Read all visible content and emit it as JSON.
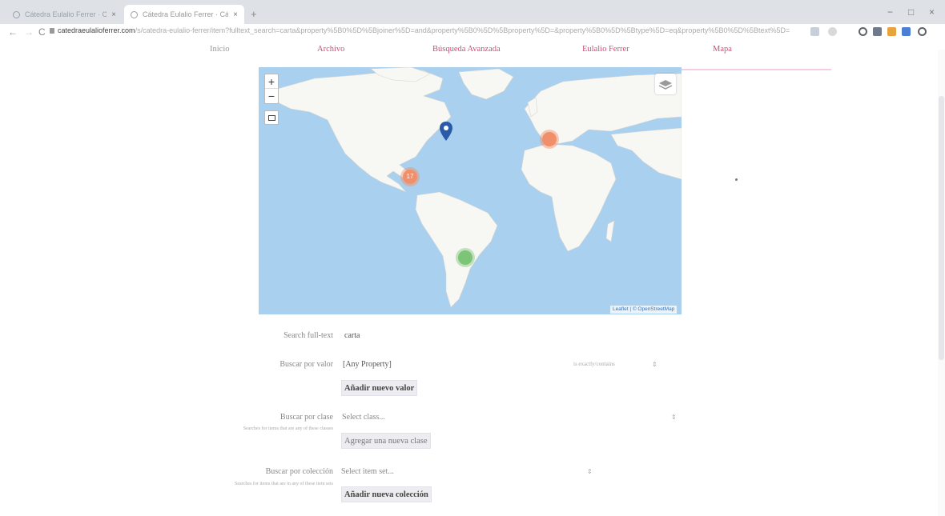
{
  "browser": {
    "tabs": [
      {
        "title": "Cátedra Eulalio Ferrer · Cátedra",
        "close": "×"
      },
      {
        "title": "Cátedra Eulalio Ferrer · Cátedra",
        "close": "×"
      }
    ],
    "new_tab": "+",
    "window_controls": {
      "minimize": "−",
      "maximize": "□",
      "close": "×"
    },
    "nav": {
      "back": "←",
      "forward": "→",
      "reload": "C"
    },
    "url_host": "catedraeulalioferrer.com",
    "url_path": "/s/catedra-eulalio-ferrer/item?fulltext_search=carta&property%5B0%5D%5Bjoiner%5D=and&property%5B0%5D%5Bproperty%5D=&property%5B0%5D%5Btype%5D=eq&property%5B0%5D%5Btext%5D="
  },
  "site_nav": {
    "inicio": "Inicio",
    "archivo": "Archivo",
    "busqueda": "Búsqueda Avanzada",
    "eulalio": "Eulalio Ferrer",
    "mapa": "Mapa"
  },
  "map": {
    "zoom_in": "+",
    "zoom_out": "−",
    "attribution": "Leaflet | © OpenStreetMap",
    "markers": [
      {
        "name": "mexico-cluster",
        "count": "17",
        "color": "#f28f6b"
      },
      {
        "name": "spain-cluster",
        "count": "",
        "color": "#f28f6b"
      },
      {
        "name": "argentina-cluster",
        "count": "",
        "color": "#7cc576"
      }
    ],
    "pin_color": "#2a5ba8",
    "water_color": "#a9d0ee",
    "land_color": "#f7f7f4"
  },
  "form": {
    "fulltext": {
      "label": "Search full-text",
      "value": "carta"
    },
    "valor": {
      "label": "Buscar por valor",
      "property": "[Any Property]",
      "condition": "is exactly/contains",
      "add": "Añadir nuevo valor"
    },
    "clase": {
      "label": "Buscar por clase",
      "placeholder": "Select class...",
      "hint": "Searches for items that are any of these classes",
      "add": "Agregar una nueva clase"
    },
    "coleccion": {
      "label": "Buscar por colección",
      "placeholder": "Select item set...",
      "hint": "Searches for items that are in any of these item sets",
      "add": "Añadir nueva colección"
    }
  }
}
